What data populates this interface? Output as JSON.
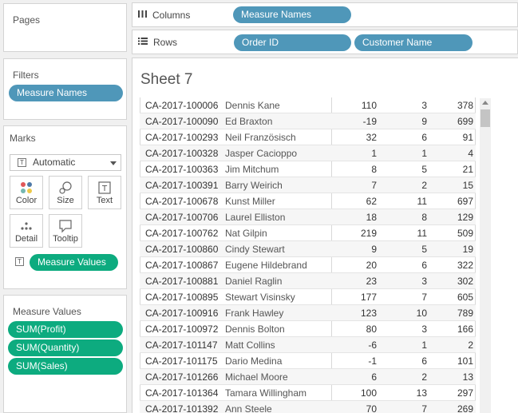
{
  "cards": {
    "pages": {
      "title": "Pages"
    },
    "filters": {
      "title": "Filters",
      "pill": "Measure Names"
    },
    "marks": {
      "title": "Marks",
      "mark_type": "Automatic",
      "buttons": {
        "color": "Color",
        "size": "Size",
        "text": "Text",
        "detail": "Detail",
        "tooltip": "Tooltip"
      },
      "text_pill": "Measure Values"
    },
    "measure_values": {
      "title": "Measure Values",
      "pills": [
        "SUM(Profit)",
        "SUM(Quantity)",
        "SUM(Sales)"
      ]
    }
  },
  "shelves": {
    "columns": {
      "label": "Columns",
      "pills": [
        "Measure Names"
      ]
    },
    "rows": {
      "label": "Rows",
      "pills": [
        "Order ID",
        "Customer Name"
      ]
    }
  },
  "sheet": {
    "title": "Sheet 7",
    "rows": [
      {
        "order_id": "CA-2017-100006",
        "customer": "Dennis Kane",
        "profit": "110",
        "quantity": "3",
        "sales": "378"
      },
      {
        "order_id": "CA-2017-100090",
        "customer": "Ed Braxton",
        "profit": "-19",
        "quantity": "9",
        "sales": "699"
      },
      {
        "order_id": "CA-2017-100293",
        "customer": "Neil Französisch",
        "profit": "32",
        "quantity": "6",
        "sales": "91"
      },
      {
        "order_id": "CA-2017-100328",
        "customer": "Jasper Cacioppo",
        "profit": "1",
        "quantity": "1",
        "sales": "4"
      },
      {
        "order_id": "CA-2017-100363",
        "customer": "Jim Mitchum",
        "profit": "8",
        "quantity": "5",
        "sales": "21"
      },
      {
        "order_id": "CA-2017-100391",
        "customer": "Barry Weirich",
        "profit": "7",
        "quantity": "2",
        "sales": "15"
      },
      {
        "order_id": "CA-2017-100678",
        "customer": "Kunst Miller",
        "profit": "62",
        "quantity": "11",
        "sales": "697"
      },
      {
        "order_id": "CA-2017-100706",
        "customer": "Laurel Elliston",
        "profit": "18",
        "quantity": "8",
        "sales": "129"
      },
      {
        "order_id": "CA-2017-100762",
        "customer": "Nat Gilpin",
        "profit": "219",
        "quantity": "11",
        "sales": "509"
      },
      {
        "order_id": "CA-2017-100860",
        "customer": "Cindy Stewart",
        "profit": "9",
        "quantity": "5",
        "sales": "19"
      },
      {
        "order_id": "CA-2017-100867",
        "customer": "Eugene Hildebrand",
        "profit": "20",
        "quantity": "6",
        "sales": "322"
      },
      {
        "order_id": "CA-2017-100881",
        "customer": "Daniel Raglin",
        "profit": "23",
        "quantity": "3",
        "sales": "302"
      },
      {
        "order_id": "CA-2017-100895",
        "customer": "Stewart Visinsky",
        "profit": "177",
        "quantity": "7",
        "sales": "605"
      },
      {
        "order_id": "CA-2017-100916",
        "customer": "Frank Hawley",
        "profit": "123",
        "quantity": "10",
        "sales": "789"
      },
      {
        "order_id": "CA-2017-100972",
        "customer": "Dennis Bolton",
        "profit": "80",
        "quantity": "3",
        "sales": "166"
      },
      {
        "order_id": "CA-2017-101147",
        "customer": "Matt Collins",
        "profit": "-6",
        "quantity": "1",
        "sales": "2"
      },
      {
        "order_id": "CA-2017-101175",
        "customer": "Dario Medina",
        "profit": "-1",
        "quantity": "6",
        "sales": "101"
      },
      {
        "order_id": "CA-2017-101266",
        "customer": "Michael Moore",
        "profit": "6",
        "quantity": "2",
        "sales": "13"
      },
      {
        "order_id": "CA-2017-101364",
        "customer": "Tamara Willingham",
        "profit": "100",
        "quantity": "13",
        "sales": "297"
      },
      {
        "order_id": "CA-2017-101392",
        "customer": "Ann Steele",
        "profit": "70",
        "quantity": "7",
        "sales": "269"
      }
    ]
  },
  "colors": {
    "dimension_pill": "#4f97b9",
    "measure_pill": "#0dab7f"
  }
}
